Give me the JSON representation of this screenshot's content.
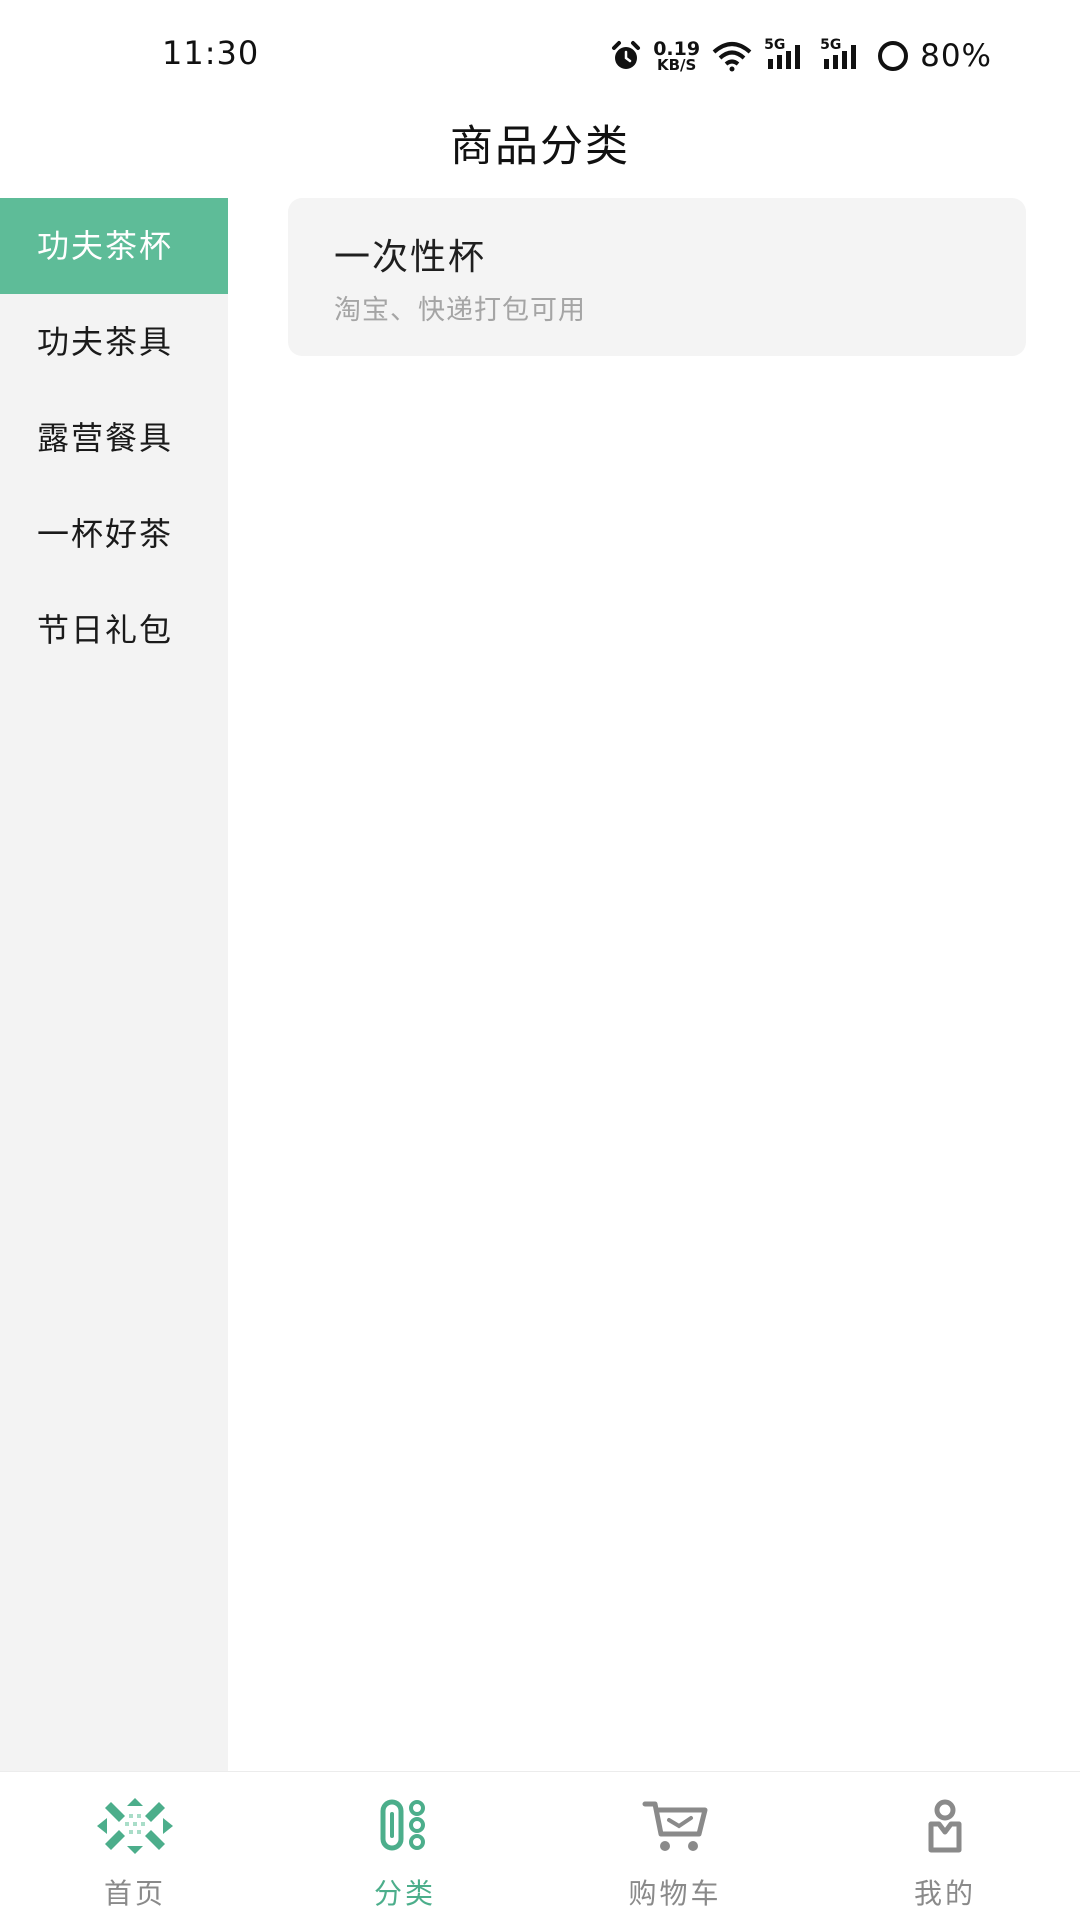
{
  "status_bar": {
    "time": "11:30",
    "net_speed_value": "0.19",
    "net_speed_unit": "KB/S",
    "signal_1_label": "5G",
    "signal_2_label": "5G",
    "battery": "80%"
  },
  "header": {
    "title": "商品分类"
  },
  "sidebar": {
    "items": [
      {
        "label": "功夫茶杯",
        "active": true
      },
      {
        "label": "功夫茶具"
      },
      {
        "label": "露营餐具"
      },
      {
        "label": "一杯好茶"
      },
      {
        "label": "节日礼包"
      }
    ]
  },
  "content": {
    "cards": [
      {
        "title": "一次性杯",
        "subtitle": "淘宝、快递打包可用"
      }
    ]
  },
  "tabbar": {
    "items": [
      {
        "label": "首页",
        "icon": "home-icon"
      },
      {
        "label": "分类",
        "icon": "category-icon",
        "active": true
      },
      {
        "label": "购物车",
        "icon": "cart-icon"
      },
      {
        "label": "我的",
        "icon": "profile-icon"
      }
    ]
  },
  "colors": {
    "accent": "#5ebc98",
    "tab_active": "#4cae8b",
    "tab_inactive": "#8a8a8a",
    "sidebar_bg": "#f3f3f3",
    "card_bg": "#f4f4f4"
  }
}
